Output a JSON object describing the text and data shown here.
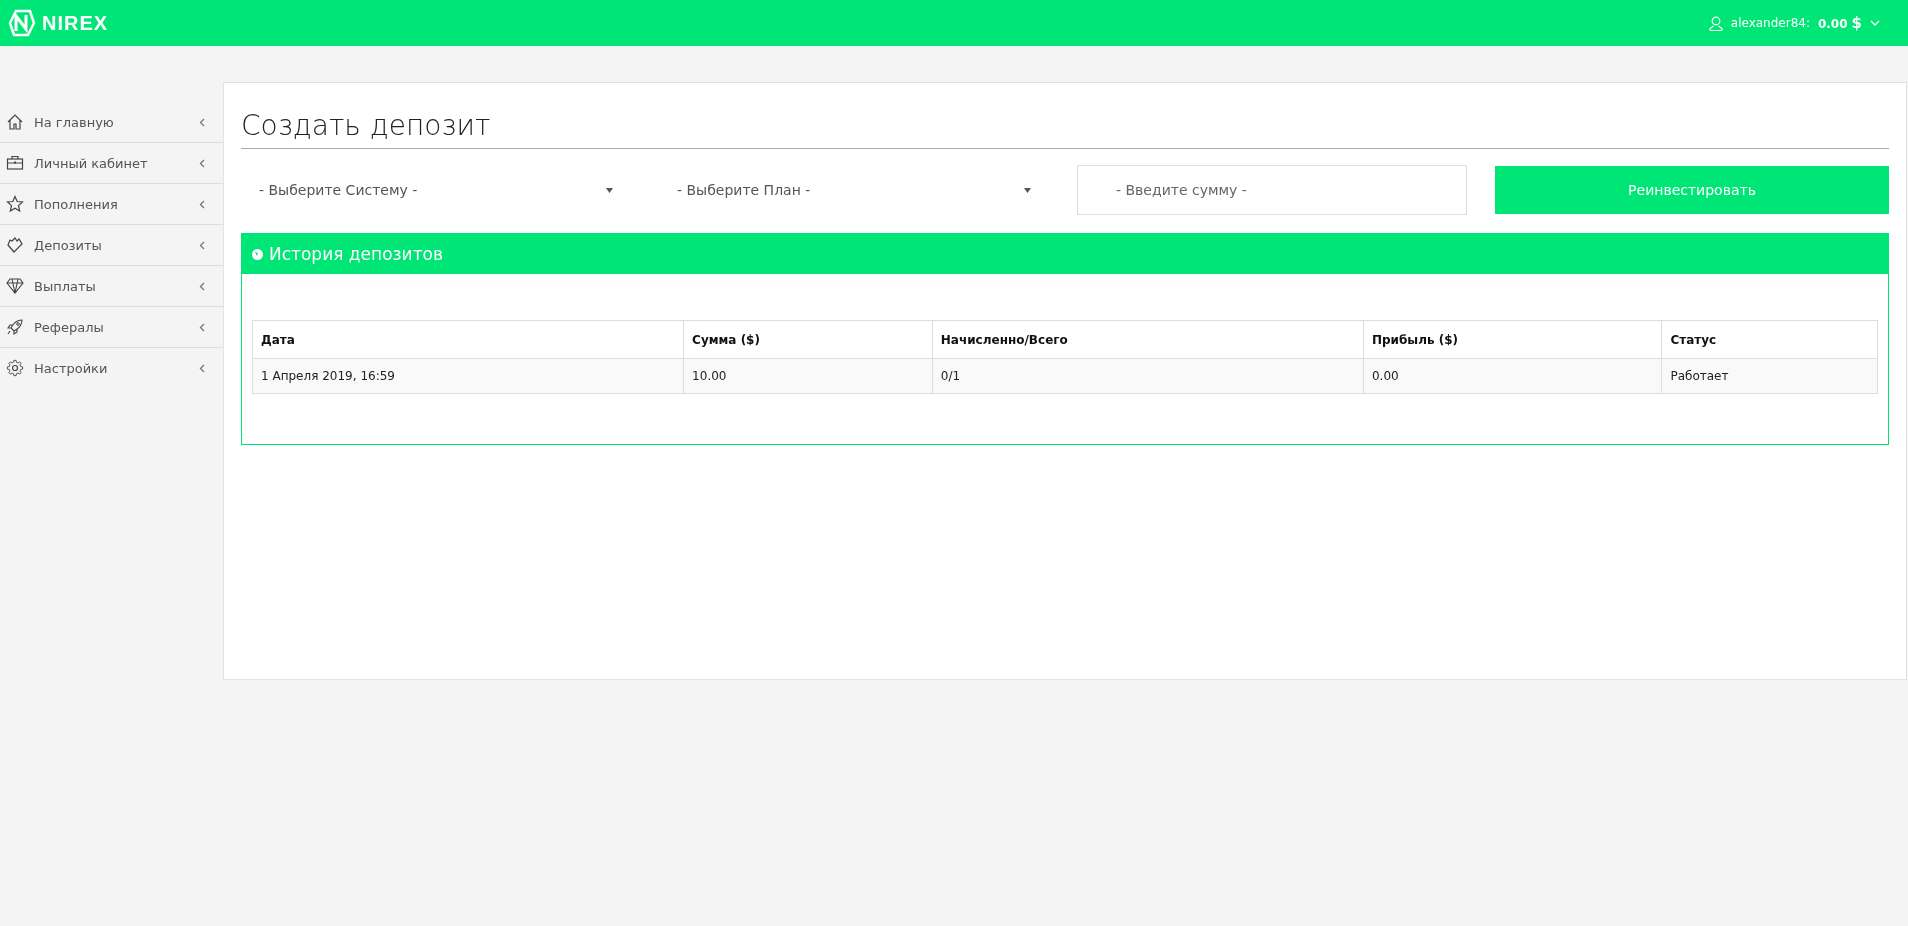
{
  "header": {
    "logo": "NIREX",
    "username": "alexander84:",
    "balance": "0.00",
    "currency": "$"
  },
  "sidebar": {
    "items": [
      {
        "label": "На главную"
      },
      {
        "label": "Личный кабинет"
      },
      {
        "label": "Пополнения"
      },
      {
        "label": "Депозиты"
      },
      {
        "label": "Выплаты"
      },
      {
        "label": "Рефералы"
      },
      {
        "label": "Настройки"
      }
    ]
  },
  "page": {
    "title": "Создать депозит",
    "system_select": {
      "placeholder": "- Выберите Систему -"
    },
    "plan_select": {
      "placeholder": "- Выберите План -"
    },
    "amount_field": {
      "placeholder": "- Введите сумму -"
    },
    "reinvest_button": "Реинвестировать"
  },
  "history": {
    "title": "История депозитов",
    "table": {
      "columns": [
        "Дата",
        "Сумма ($)",
        "Начисленно/Всего",
        "Прибыль ($)",
        "Статус"
      ],
      "rows": [
        [
          "1 Апреля 2019, 16:59",
          "10.00",
          "0/1",
          "0.00",
          "Работает"
        ]
      ]
    }
  }
}
